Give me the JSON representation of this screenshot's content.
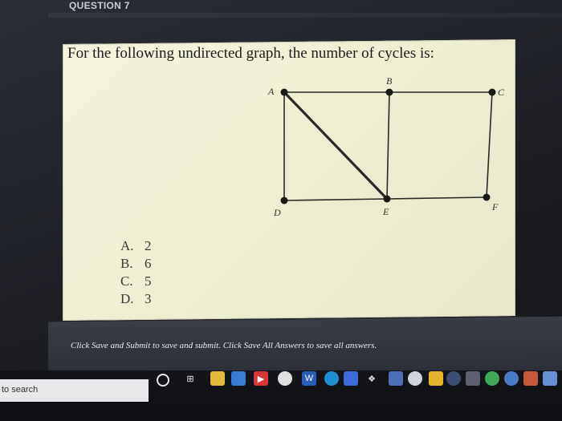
{
  "header": {
    "question_label": "QUESTION 7"
  },
  "question": {
    "text": "For the following undirected graph, the number of cycles is:"
  },
  "graph": {
    "nodes": [
      {
        "label": "A"
      },
      {
        "label": "B"
      },
      {
        "label": "C"
      },
      {
        "label": "D"
      },
      {
        "label": "E"
      },
      {
        "label": "F"
      }
    ]
  },
  "answers": [
    {
      "key": "A.",
      "value": "2"
    },
    {
      "key": "B.",
      "value": "6"
    },
    {
      "key": "C.",
      "value": "5"
    },
    {
      "key": "D.",
      "value": "3"
    }
  ],
  "footer": {
    "text": "Click Save and Submit to save and submit. Click Save All Answers to save all answers."
  },
  "taskbar": {
    "search_text": "to search",
    "icons": [
      "cortana-icon",
      "task-view-icon",
      "file-explorer-icon",
      "mail-icon",
      "youtube-icon",
      "chrome-icon",
      "word-icon",
      "edge-icon",
      "store-icon",
      "dropbox-icon",
      "photos-icon",
      "music-icon",
      "sticky-notes-icon",
      "steam-icon",
      "settings-icon",
      "teams-icon",
      "app-icon",
      "app-icon",
      "app-icon"
    ]
  }
}
